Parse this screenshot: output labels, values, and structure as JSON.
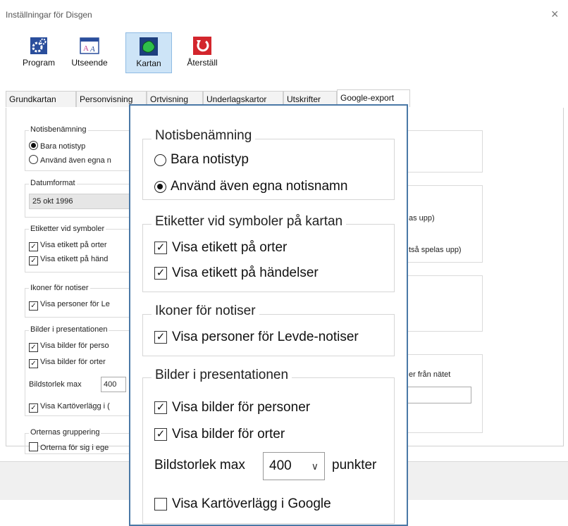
{
  "window": {
    "title": "Inställningar för Disgen",
    "close_glyph": "×"
  },
  "toolbar": [
    {
      "label": "Program",
      "icon": "gear-icon"
    },
    {
      "label": "Utseende",
      "icon": "font-icon"
    },
    {
      "label": "Kartan",
      "icon": "map-icon"
    },
    {
      "label": "Återställ",
      "icon": "reset-icon"
    }
  ],
  "tabs": [
    "Grundkartan",
    "Personvisning",
    "Ortvisning",
    "Underlagskartor",
    "Utskrifter",
    "Google-export"
  ],
  "selected_tab": "Google-export",
  "background": {
    "notis_legend": "Notisbenämning",
    "notis_opt1": "Bara notistyp",
    "notis_opt2": "Använd även egna n",
    "datum_legend": "Datumformat",
    "datum_value": "25 okt 1996",
    "etik_legend": "Etiketter vid symboler",
    "etik_1": "Visa etikett på orter",
    "etik_2": "Visa etikett på händ",
    "ikon_legend": "Ikoner för notiser",
    "ikon_1": "Visa personer för Le",
    "bild_legend": "Bilder i presentationen",
    "bild_1": "Visa bilder för perso",
    "bild_2": "Visa bilder för orter",
    "bild_size_label": "Bildstorlek max",
    "bild_size_value": "400",
    "bild_3": "Visa Kartöverlägg i (",
    "ort_legend": "Orternas gruppering",
    "ort_1": "Orterna för sig i ege",
    "right_1": "as upp)",
    "right_2": "tså spelas upp)",
    "right_3": "er från nätet"
  },
  "zoom": {
    "notis_legend": "Notisbenämning",
    "notis_opt1": "Bara notistyp",
    "notis_opt2": "Använd även egna notisnamn",
    "notis_selected": 2,
    "etik_legend": "Etiketter vid symboler på kartan",
    "etik_1": "Visa etikett på orter",
    "etik_2": "Visa etikett på händelser",
    "ikon_legend": "Ikoner för notiser",
    "ikon_1": "Visa personer för Levde-notiser",
    "bild_legend": "Bilder i presentationen",
    "bild_1": "Visa bilder för personer",
    "bild_2": "Visa bilder för orter",
    "bild_size_label": "Bildstorlek max",
    "bild_size_value": "400",
    "bild_size_unit": "punkter",
    "bild_3": "Visa Kartöverlägg i Google",
    "check_glyph": "✓",
    "chevron_glyph": "∨"
  }
}
